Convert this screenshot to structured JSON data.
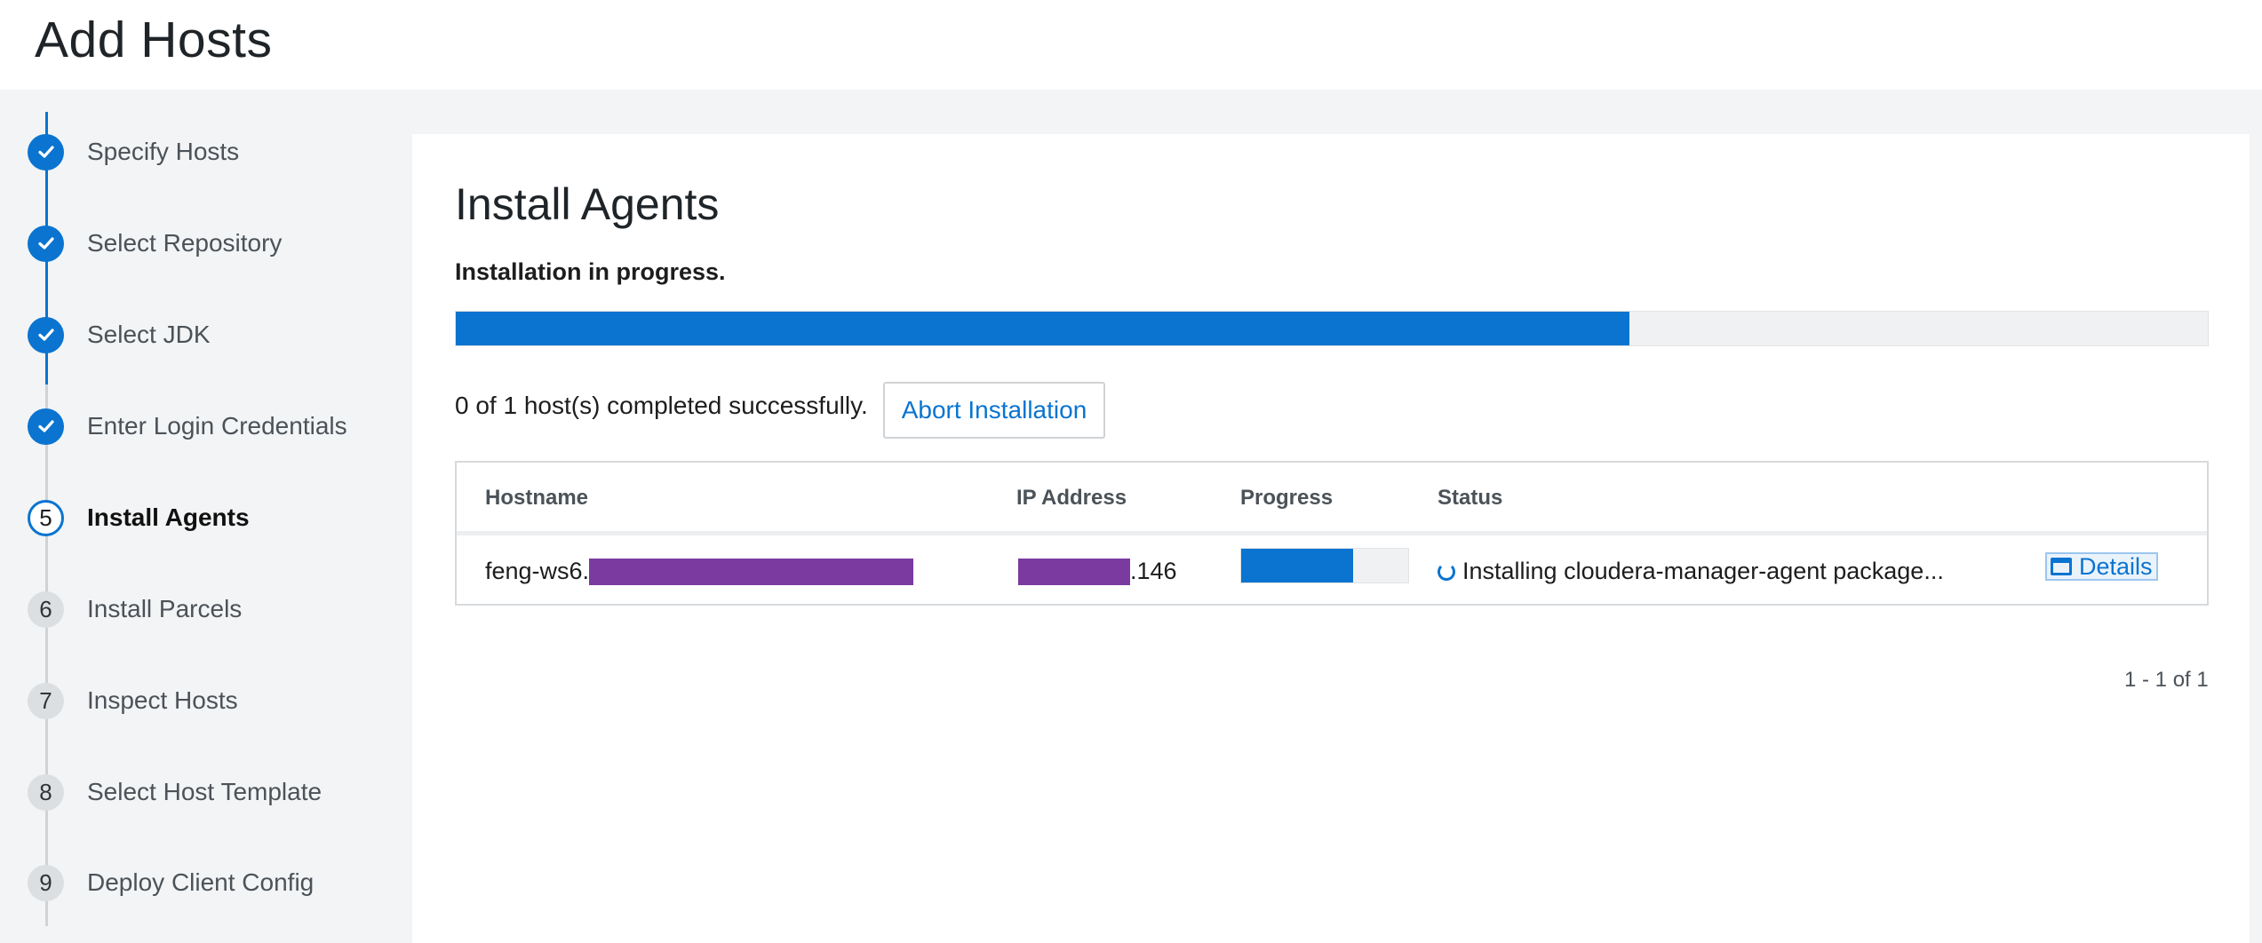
{
  "page": {
    "title": "Add Hosts"
  },
  "steps": [
    {
      "number": "1",
      "label": "Specify Hosts",
      "state": "done"
    },
    {
      "number": "2",
      "label": "Select Repository",
      "state": "done"
    },
    {
      "number": "3",
      "label": "Select JDK",
      "state": "done"
    },
    {
      "number": "4",
      "label": "Enter Login Credentials",
      "state": "done"
    },
    {
      "number": "5",
      "label": "Install Agents",
      "state": "current"
    },
    {
      "number": "6",
      "label": "Install Parcels",
      "state": "todo"
    },
    {
      "number": "7",
      "label": "Inspect Hosts",
      "state": "todo"
    },
    {
      "number": "8",
      "label": "Select Host Template",
      "state": "todo"
    },
    {
      "number": "9",
      "label": "Deploy Client Config",
      "state": "todo"
    }
  ],
  "main": {
    "title": "Install Agents",
    "status": "Installation in progress.",
    "overall_progress_percent": 67,
    "completed_text": "0 of 1 host(s) completed successfully.",
    "abort_button": "Abort Installation"
  },
  "table": {
    "columns": [
      "Hostname",
      "IP Address",
      "Progress",
      "Status"
    ],
    "rows": [
      {
        "hostname_prefix": "feng-ws6.",
        "ip_suffix": ".146",
        "progress_percent": 67,
        "status": "Installing cloudera-manager-agent package...",
        "details_label": "Details"
      }
    ],
    "pagination": "1 - 1 of 1"
  },
  "colors": {
    "accent": "#0a74d0",
    "redaction": "#7a3aa0"
  },
  "icons": {
    "step_done": "check-circle-icon",
    "status": "spinner-icon",
    "details": "window-icon"
  }
}
